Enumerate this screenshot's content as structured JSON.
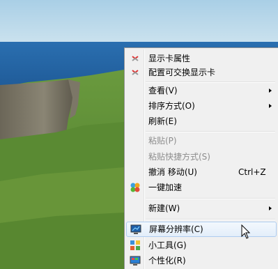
{
  "menu": {
    "items": [
      {
        "label": "显示卡属性",
        "icon": "graphics-card-icon"
      },
      {
        "label": "配置可交换显示卡",
        "icon": "graphics-card-icon"
      },
      {
        "label": "查看(V)",
        "submenu": true
      },
      {
        "label": "排序方式(O)",
        "submenu": true
      },
      {
        "label": "刷新(E)"
      },
      {
        "label": "粘贴(P)",
        "disabled": true
      },
      {
        "label": "粘贴快捷方式(S)",
        "disabled": true
      },
      {
        "label": "撤消 移动(U)",
        "shortcut": "Ctrl+Z"
      },
      {
        "label": "一键加速",
        "icon": "speed-up-icon"
      },
      {
        "label": "新建(W)",
        "submenu": true
      },
      {
        "label": "屏幕分辨率(C)",
        "icon": "display-icon",
        "hovered": true
      },
      {
        "label": "小工具(G)",
        "icon": "gadgets-icon"
      },
      {
        "label": "个性化(R)",
        "icon": "personalize-icon"
      }
    ]
  },
  "colors": {
    "menu_background": "#f0f0f0",
    "hover_border": "#aeccf0",
    "disabled_text": "#8d8d8d"
  }
}
